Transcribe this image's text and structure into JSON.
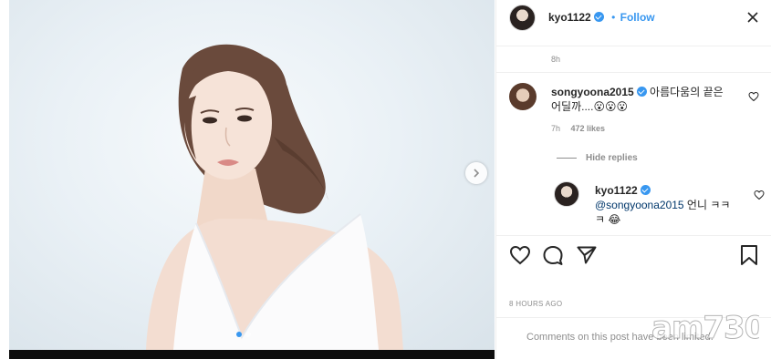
{
  "header": {
    "username": "kyo1122",
    "follow_label": "Follow",
    "bullet": "•",
    "more_label": "···"
  },
  "post": {
    "time": "8h",
    "ago": "8 HOURS AGO",
    "comments_notice": "Comments on this post have been limited."
  },
  "comment": {
    "username": "songyoona2015",
    "text": "아름다움의 끝은 어딜까....😮😮😮",
    "time": "7h",
    "likes": "472 likes"
  },
  "hide_replies": "Hide replies",
  "reply": {
    "username": "kyo1122",
    "mention": "@songyoona2015",
    "text": " 언니 ㅋㅋㅋ 😂"
  },
  "watermark": "am730",
  "photo": {
    "carousel_total": 2,
    "carousel_active": 1
  },
  "colors": {
    "accent": "#3897f0",
    "muted": "#8e8e8e",
    "text": "#262626"
  },
  "icons": [
    "close-icon",
    "verified-icon",
    "heart-icon",
    "comment-icon",
    "share-icon",
    "bookmark-icon",
    "chevron-right-icon"
  ]
}
